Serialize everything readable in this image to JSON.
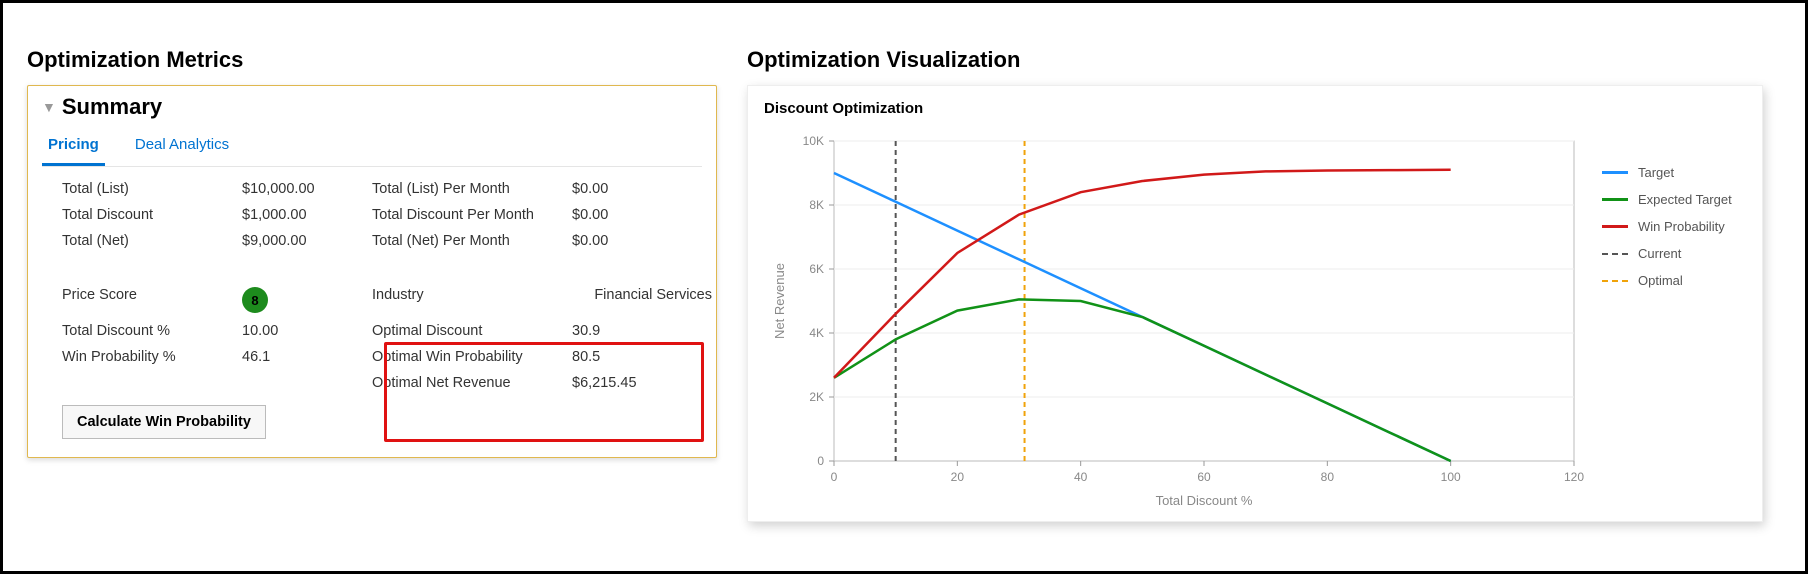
{
  "left": {
    "panel_title": "Optimization Metrics",
    "summary_label": "Summary",
    "tabs": {
      "pricing": "Pricing",
      "deal_analytics": "Deal Analytics"
    },
    "rows": {
      "total_list_label": "Total (List)",
      "total_list_value": "$10,000.00",
      "total_list_pm_label": "Total (List) Per Month",
      "total_list_pm_value": "$0.00",
      "total_discount_label": "Total Discount",
      "total_discount_value": "$1,000.00",
      "total_discount_pm_label": "Total Discount Per Month",
      "total_discount_pm_value": "$0.00",
      "total_net_label": "Total (Net)",
      "total_net_value": "$9,000.00",
      "total_net_pm_label": "Total (Net) Per Month",
      "total_net_pm_value": "$0.00",
      "price_score_label": "Price Score",
      "price_score_value": "8",
      "industry_label": "Industry",
      "industry_value": "Financial Services",
      "total_discount_pct_label": "Total Discount %",
      "total_discount_pct_value": "10.00",
      "optimal_discount_label": "Optimal Discount",
      "optimal_discount_value": "30.9",
      "win_prob_label": "Win Probability %",
      "win_prob_value": "46.1",
      "optimal_win_prob_label": "Optimal Win Probability",
      "optimal_win_prob_value": "80.5",
      "optimal_net_rev_label": "Optimal Net Revenue",
      "optimal_net_rev_value": "$6,215.45"
    },
    "calc_button": "Calculate Win Probability"
  },
  "right": {
    "panel_title": "Optimization Visualization",
    "chart_title": "Discount Optimization",
    "xlabel": "Total Discount %",
    "ylabel": "Net Revenue",
    "legend": {
      "target": "Target",
      "expected_target": "Expected Target",
      "win_probability": "Win Probability",
      "current": "Current",
      "optimal": "Optimal"
    },
    "y_ticks": [
      "0",
      "2K",
      "4K",
      "6K",
      "8K",
      "10K"
    ],
    "x_ticks": [
      "0",
      "20",
      "40",
      "60",
      "80",
      "100",
      "120"
    ]
  },
  "colors": {
    "target": "#1e90ff",
    "expected": "#119217",
    "winprob": "#d11919",
    "current": "#555555",
    "optimal": "#f0a30a"
  },
  "chart_data": {
    "type": "line",
    "title": "Discount Optimization",
    "xlabel": "Total Discount %",
    "ylabel": "Net Revenue",
    "xlim": [
      0,
      120
    ],
    "ylim": [
      0,
      10000
    ],
    "x": [
      0,
      10,
      20,
      30,
      40,
      50,
      60,
      70,
      80,
      90,
      100
    ],
    "series": [
      {
        "name": "Target",
        "color": "#1e90ff",
        "values": [
          9000,
          8100,
          7200,
          6300,
          5400,
          4500,
          3600,
          2700,
          1800,
          900,
          0
        ]
      },
      {
        "name": "Expected Target",
        "color": "#119217",
        "values": [
          2600,
          3800,
          4700,
          5050,
          5000,
          4500,
          3600,
          2700,
          1800,
          900,
          0
        ]
      },
      {
        "name": "Win Probability",
        "color": "#d11919",
        "values": [
          2600,
          4600,
          6500,
          7700,
          8400,
          8750,
          8950,
          9050,
          9080,
          9090,
          9100
        ]
      }
    ],
    "vlines": [
      {
        "name": "Current",
        "x": 10,
        "color": "#555555",
        "dash": true
      },
      {
        "name": "Optimal",
        "x": 30.9,
        "color": "#f0a30a",
        "dash": true
      }
    ]
  }
}
